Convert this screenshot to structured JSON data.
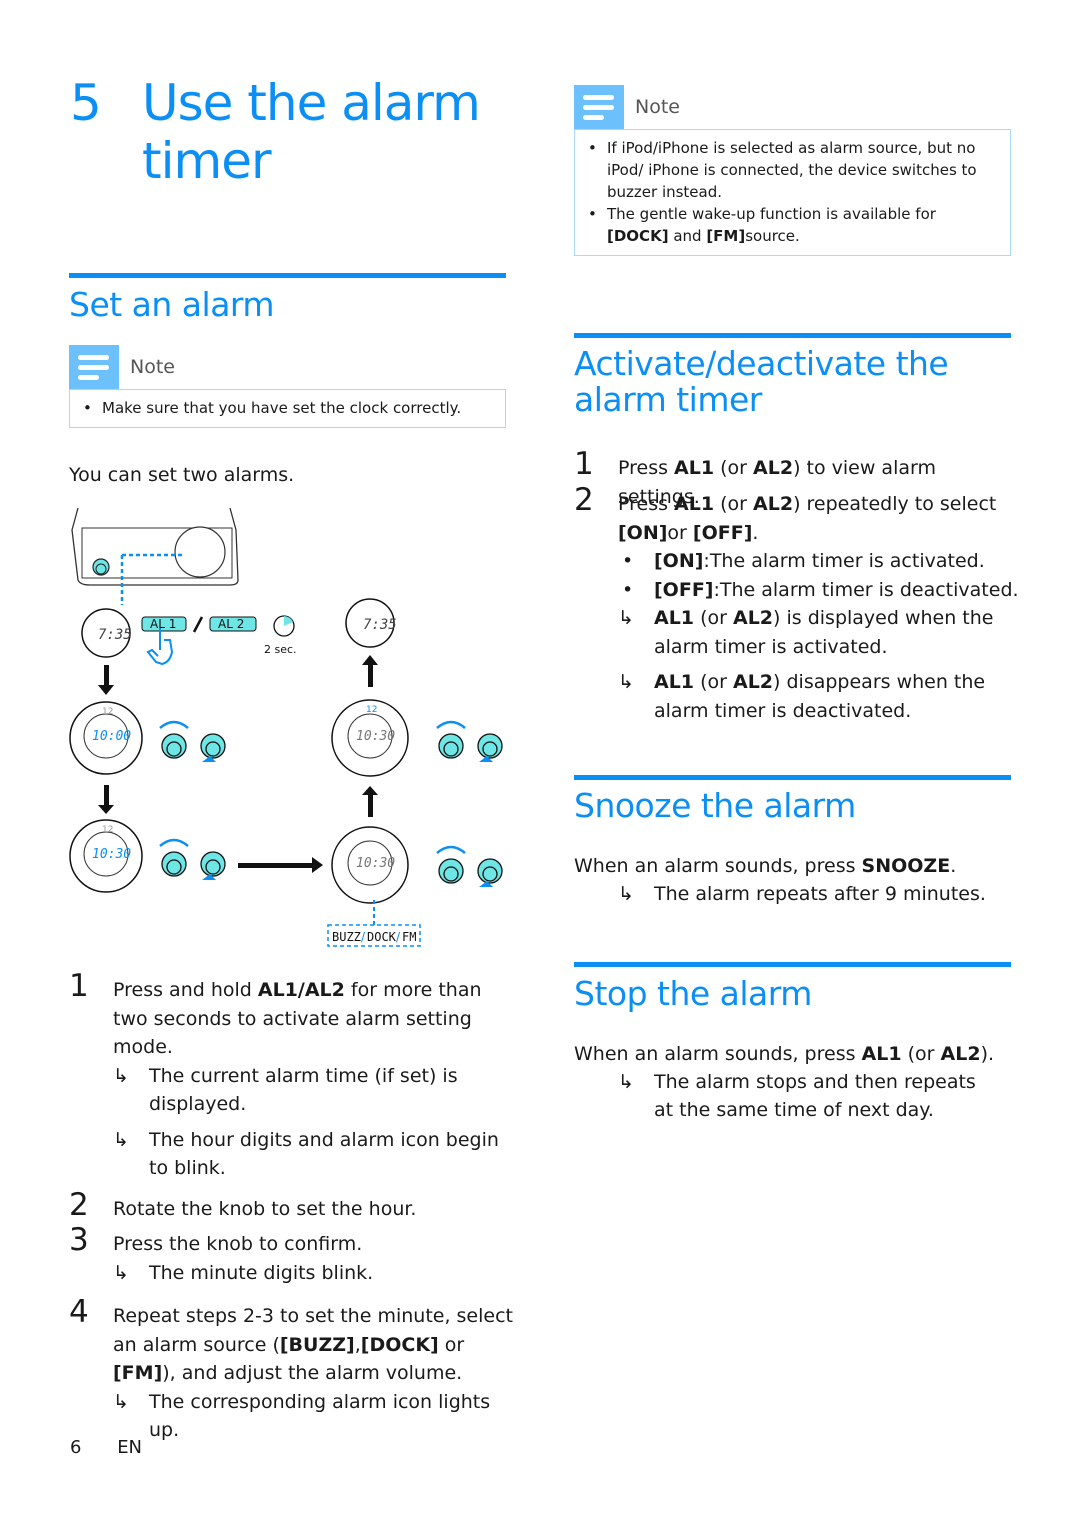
{
  "chapter": {
    "number": "5",
    "title": "Use the alarm timer"
  },
  "set_alarm": {
    "heading": "Set an alarm",
    "note_label": "Note",
    "note_items": [
      "Make sure that you have set the clock correctly."
    ],
    "intro": "You can set two alarms.",
    "diagram": {
      "buttons": [
        "AL 1",
        "AL 2"
      ],
      "hold_time": "2 sec.",
      "display_times": [
        "7:35",
        "10:00",
        "10:30",
        "10:30",
        "10:30",
        "7:35"
      ],
      "hour_mark": "12",
      "alarm_sources": [
        "BUZZ",
        "DOCK",
        "FM"
      ],
      "al_indicator": "AL1"
    },
    "steps": [
      {
        "num": "1",
        "parts": [
          "Press and hold ",
          "AL1/AL2",
          " for more than two seconds to activate alarm setting mode."
        ],
        "results": [
          "The current alarm time (if set) is displayed.",
          "The hour digits and alarm icon begin to blink."
        ]
      },
      {
        "num": "2",
        "text": "Rotate the knob to set the hour."
      },
      {
        "num": "3",
        "text": "Press the knob to confirm.",
        "results": [
          "The minute digits blink."
        ]
      },
      {
        "num": "4",
        "parts": [
          "Repeat steps 2-3 to set the minute, select an alarm source (",
          "[BUZZ]",
          ",",
          "[DOCK]",
          " or ",
          "[FM]",
          "), and adjust the alarm volume."
        ],
        "results": [
          "The corresponding alarm icon lights up."
        ]
      }
    ]
  },
  "top_note": {
    "label": "Note",
    "items": [
      {
        "text": "If iPod/iPhone is selected as alarm source, but no iPod/ iPhone is connected, the device switches to buzzer instead."
      },
      {
        "parts": [
          "The gentle wake-up function is available for ",
          "[DOCK]",
          " and ",
          "[FM]",
          "source."
        ]
      }
    ]
  },
  "activate": {
    "heading": "Activate/deactivate the alarm timer",
    "steps": [
      {
        "num": "1",
        "parts": [
          "Press ",
          "AL1",
          " (or ",
          "AL2",
          ") to view alarm settings."
        ]
      },
      {
        "num": "2",
        "parts": [
          "Press ",
          "AL1",
          " (or ",
          "AL2",
          ") repeatedly to select ",
          "[ON]",
          "or ",
          "[OFF]",
          "."
        ]
      }
    ],
    "bullets": [
      {
        "key": "[ON]",
        "text": ":The alarm timer is activated."
      },
      {
        "key": "[OFF]",
        "text": ":The alarm timer is deactivated."
      }
    ],
    "results": [
      {
        "a": "AL1",
        "b": " (or ",
        "c": "AL2",
        "d": ") is displayed when the alarm timer is activated."
      },
      {
        "a": "AL1",
        "b": " (or ",
        "c": "AL2",
        "d": ") disappears when the alarm timer is deactivated."
      }
    ]
  },
  "snooze": {
    "heading": "Snooze the alarm",
    "text_pre": "When an alarm sounds, press ",
    "key": "SNOOZE",
    "text_post": ".",
    "result": "The alarm repeats after 9 minutes."
  },
  "stop": {
    "heading": "Stop the alarm",
    "text_pre": "When an alarm sounds, press ",
    "key1": "AL1",
    "mid": " (or ",
    "key2": "AL2",
    "text_post": ").",
    "result": "The alarm stops and then repeats at the same time of next day."
  },
  "footer": {
    "page": "6",
    "lang": "EN"
  },
  "symbols": {
    "result_arrow": "↳",
    "bullet": "•"
  },
  "colors": {
    "accent": "#0b8ff5",
    "note_icon": "#6cc0fb",
    "note_border": "#a8d8fa",
    "device_teal": "#6fe6e6"
  }
}
